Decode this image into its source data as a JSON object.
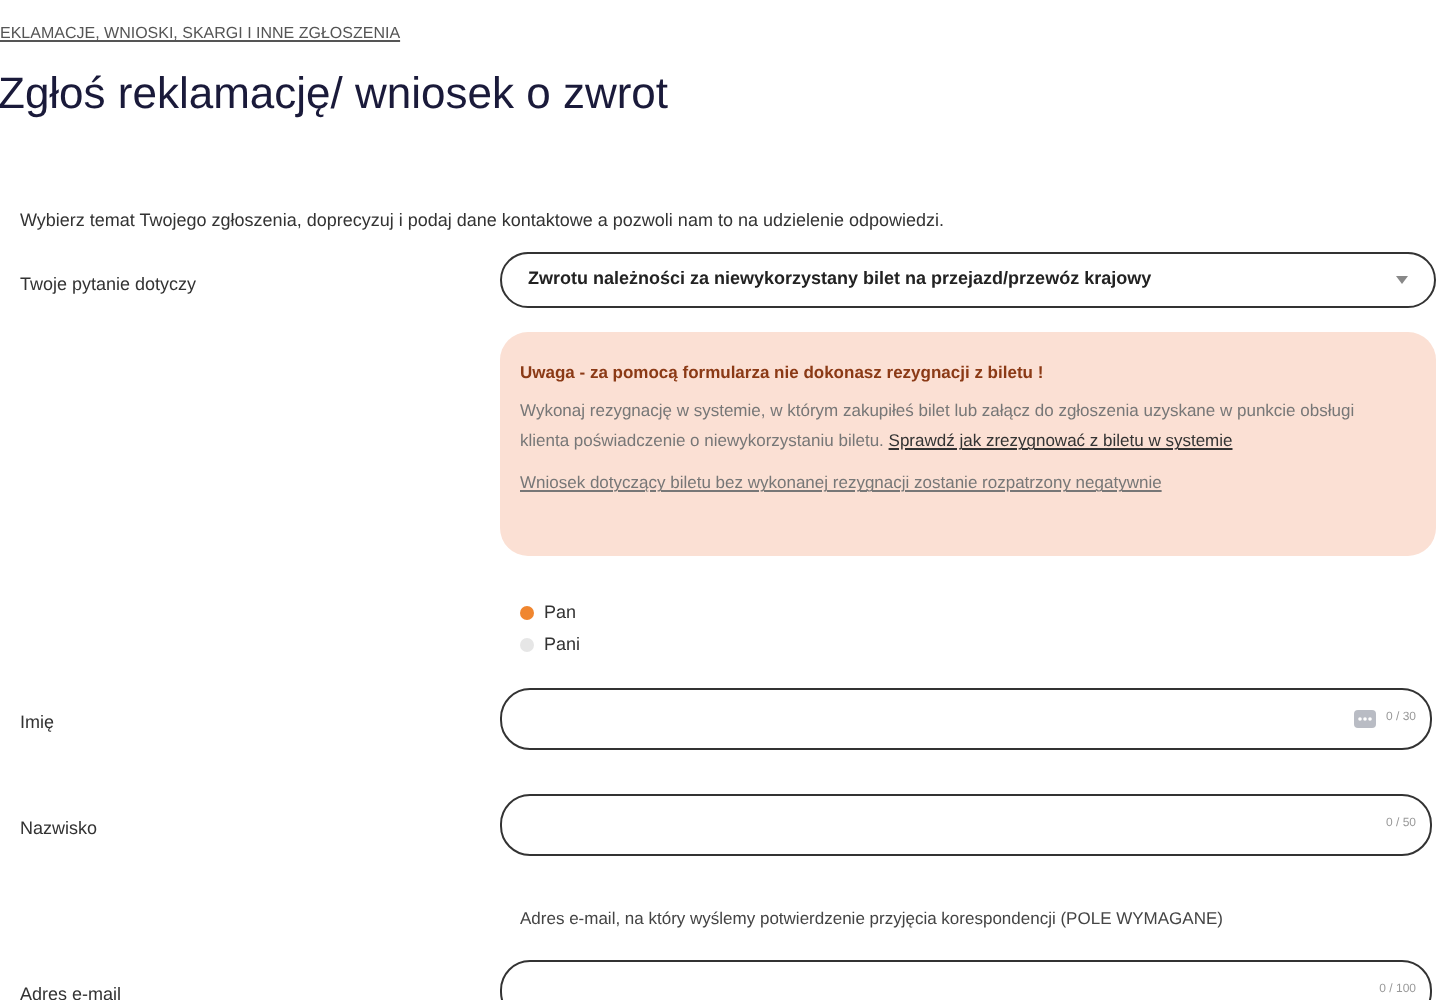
{
  "breadcrumb": "EKLAMACJE, WNIOSKI, SKARGI I INNE ZGŁOSZENIA",
  "title": "Zgłoś reklamację/ wniosek o zwrot",
  "intro": "Wybierz temat Twojego zgłoszenia, doprecyzuj i podaj dane kontaktowe a pozwoli nam to na udzielenie odpowiedzi.",
  "topic": {
    "label": "Twoje pytanie dotyczy",
    "value": "Zwrotu należności za niewykorzystany bilet na przejazd/przewóz krajowy"
  },
  "warning": {
    "title": "Uwaga - za pomocą formularza nie dokonasz rezygnacji z biletu !",
    "text": "Wykonaj rezygnację w systemie, w którym zakupiłeś bilet lub załącz do zgłoszenia uzyskane w punkcie obsługi klienta poświadczenie o niewykorzystaniu biletu.",
    "link": "Sprawdź jak zrezygnować z biletu w systemie",
    "note_link": "Wniosek dotyczący biletu bez wykonanej rezygnacji zostanie rozpatrzony negatywnie"
  },
  "salutation": [
    {
      "label": "Pan",
      "selected": true
    },
    {
      "label": "Pani",
      "selected": false
    }
  ],
  "fields": [
    {
      "label": "Imię",
      "counter": "0 / 30",
      "autofill_icon": true
    },
    {
      "label": "Nazwisko",
      "counter": "0 / 50",
      "autofill_icon": false
    },
    {
      "label": "Adres e-mail",
      "counter": "0 / 100",
      "autofill_icon": false,
      "note": "Adres e-mail, na który wyślemy potwierdzenie przyjęcia korespondencji (POLE WYMAGANE)"
    }
  ]
}
